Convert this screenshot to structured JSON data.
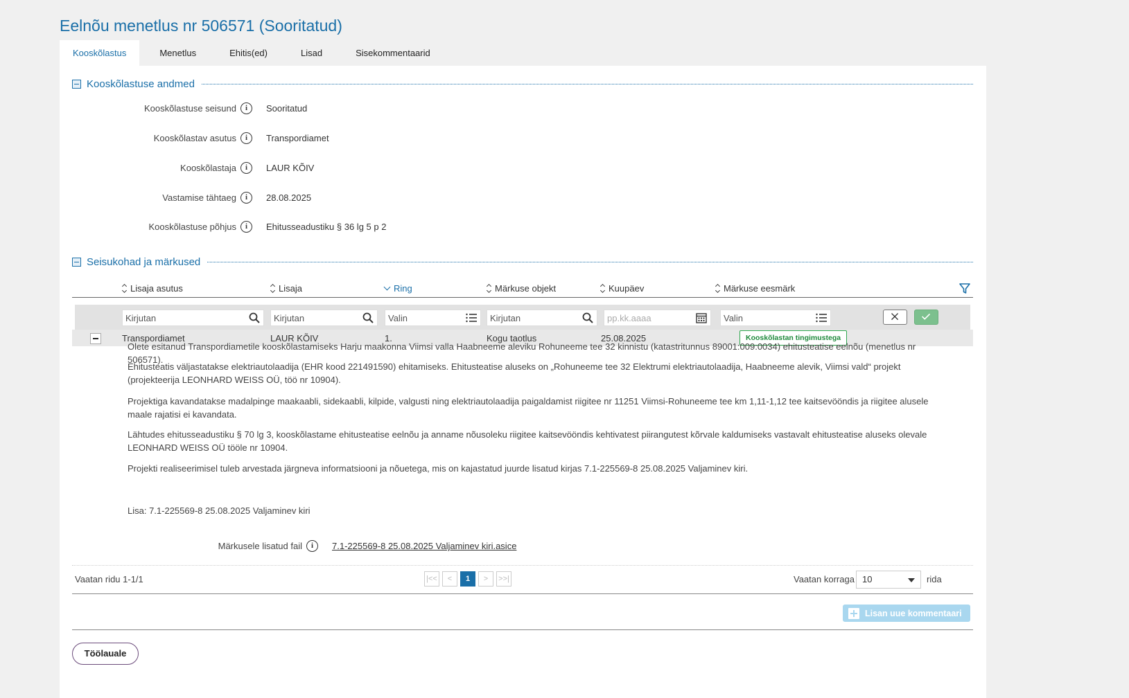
{
  "page": {
    "title": "Eelnõu menetlus nr 506571 (Sooritatud)"
  },
  "tabs": [
    {
      "label": "Kooskõlastus"
    },
    {
      "label": "Menetlus"
    },
    {
      "label": "Ehitis(ed)"
    },
    {
      "label": "Lisad"
    },
    {
      "label": "Sisekommentaarid"
    }
  ],
  "section1": {
    "title": "Kooskõlastuse andmed",
    "fields": [
      {
        "label": "Kooskõlastuse seisund",
        "value": "Sooritatud"
      },
      {
        "label": "Kooskõlastav asutus",
        "value": "Transpordiamet"
      },
      {
        "label": "Kooskõlastaja",
        "value": "LAUR KÕIV"
      },
      {
        "label": "Vastamise tähtaeg",
        "value": "28.08.2025"
      },
      {
        "label": "Kooskõlastuse põhjus",
        "value": "Ehitusseadustiku § 36 lg 5 p 2"
      }
    ]
  },
  "section2": {
    "title": "Seisukohad ja märkused",
    "columns": [
      {
        "label": "Lisaja asutus"
      },
      {
        "label": "Lisaja"
      },
      {
        "label": "Ring"
      },
      {
        "label": "Märkuse objekt"
      },
      {
        "label": "Kuupäev"
      },
      {
        "label": "Märkuse eesmärk"
      }
    ],
    "filters": {
      "lisaja_asutus": "Kirjutan",
      "lisaja": "Kirjutan",
      "ring": "Valin",
      "objekt": "Kirjutan",
      "kuupaev": "pp.kk.aaaa",
      "eesmark": "Valin"
    },
    "row": {
      "asutus": "Transpordiamet",
      "lisaja": "LAUR KÕIV",
      "ring": "1.",
      "objekt": "Kogu taotlus",
      "kuupaev": "25.08.2025",
      "eesmark": "Kooskõlastan tingimustega"
    },
    "comment": {
      "p1": "Olete esitanud Transpordiametile kooskõlastamiseks Harju maakonna Viimsi valla Haabneeme aleviku Rohuneeme tee 32 kinnistu (katastritunnus 89001:009:0034) ehitusteatise eelnõu (menetlus nr 506571).",
      "p2": "Ehitusteatis väljastatakse elektriautolaadija (EHR kood 221491590) ehitamiseks. Ehitusteatise aluseks on „Rohuneeme tee 32 Elektrumi elektriautolaadija, Haabneeme alevik, Viimsi vald“ projekt (projekteerija LEONHARD WEISS OÜ, töö nr 10904).",
      "p3": "Projektiga kavandatakse madalpinge maakaabli, sidekaabli, kilpide, valgusti ning elektriautolaadija paigaldamist riigitee nr 11251 Viimsi-Rohuneeme tee km 1,11-1,12 tee kaitsevööndis ja riigitee alusele maale rajatisi ei kavandata.",
      "p4": "Lähtudes ehitusseadustiku § 70 lg 3, kooskõlastame ehitusteatise eelnõu ja anname nõusoleku riigitee kaitsevööndis kehtivatest piirangutest kõrvale kaldumiseks vastavalt ehitusteatise aluseks olevale LEONHARD WEISS OÜ tööle nr 10904.",
      "p5": "Projekti realiseerimisel tuleb arvestada järgneva informatsiooni ja nõuetega, mis on kajastatud juurde lisatud kirjas 7.1-225569-8 25.08.2025 Valjaminev kiri.",
      "p6": "Lisa: 7.1-225569-8 25.08.2025 Valjaminev kiri"
    },
    "file": {
      "label": "Märkusele lisatud fail",
      "name": "7.1-225569-8 25.08.2025 Valjaminev kiri.asice"
    },
    "pager": {
      "info": "Vaatan ridu 1-1/1",
      "first": "|<<",
      "prev": "<",
      "current": "1",
      "next": ">",
      "last": ">>|",
      "rows_label": "Vaatan korraga",
      "rows_value": "10",
      "rows_suffix": "rida"
    },
    "add_button": "Lisan uue kommentaari"
  },
  "footer": {
    "back_button": "Töölauale"
  },
  "colors": {
    "accent": "#1a6fa8",
    "badge_green": "#2ea84f",
    "apply_green": "#7cc08e"
  }
}
